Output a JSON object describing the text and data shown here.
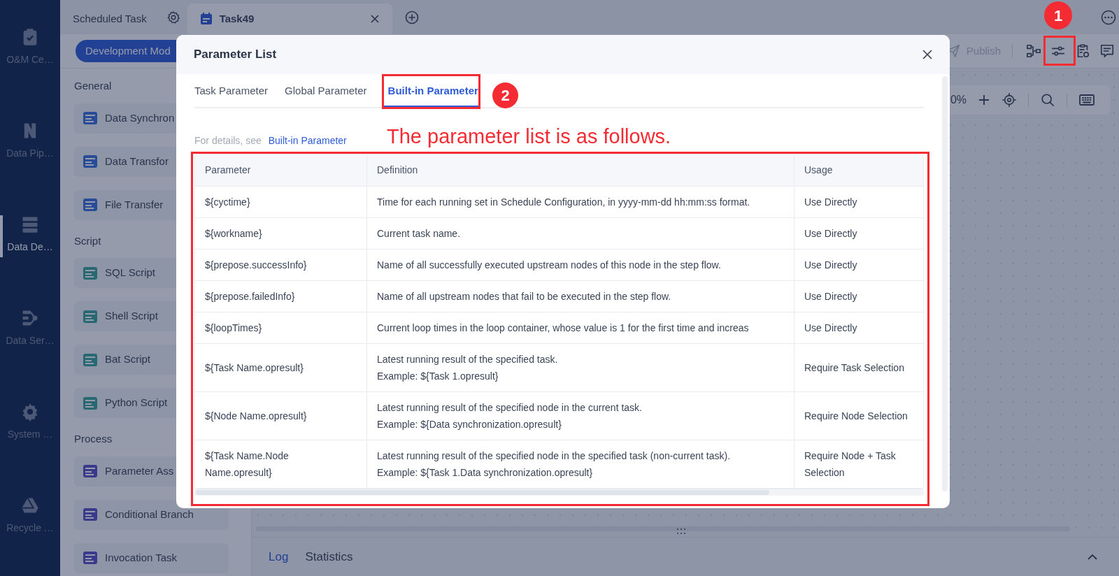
{
  "nav": [
    {
      "label": "O&M Ce…",
      "selected": false
    },
    {
      "label": "Data Pip…",
      "selected": false
    },
    {
      "label": "Data De…",
      "selected": true
    },
    {
      "label": "Data Ser…",
      "selected": false
    },
    {
      "label": "System …",
      "selected": false
    },
    {
      "label": "Recycle …",
      "selected": false
    }
  ],
  "top_tabs": [
    {
      "label": "Scheduled Task",
      "kind": "home",
      "selected": false
    },
    {
      "label": "Task49",
      "kind": "task",
      "selected": true
    }
  ],
  "mode_button": "Development Mod",
  "publish": {
    "label": "Publish",
    "disabled": true
  },
  "palette": [
    {
      "title": "General",
      "items": [
        "Data Synchron",
        "Data Transfor",
        "File Transfer"
      ]
    },
    {
      "title": "Script",
      "items": [
        "SQL Script",
        "Shell Script",
        "Bat Script",
        "Python Script"
      ]
    },
    {
      "title": "Process",
      "items": [
        "Parameter Ass",
        "Conditional Branch",
        "Invocation Task"
      ]
    }
  ],
  "zoom_toolbar": {
    "zoom": "0%"
  },
  "bottom_panel": {
    "tabs": [
      {
        "label": "Log",
        "selected": true
      },
      {
        "label": "Statistics",
        "selected": false
      }
    ]
  },
  "dialog": {
    "title": "Parameter List",
    "tabs": [
      {
        "label": "Task Parameter",
        "selected": false,
        "highlighted": false
      },
      {
        "label": "Global Parameter",
        "selected": false,
        "highlighted": false
      },
      {
        "label": "Built-in Parameter",
        "selected": true,
        "highlighted": true
      }
    ],
    "hint": "For details, see",
    "hint_link": "Built-in Parameter",
    "columns": [
      "Parameter",
      "Definition",
      "Usage"
    ],
    "rows": [
      {
        "parameter": "${cyctime}",
        "definition": [
          "Time for each running set in Schedule Configuration, in yyyy-mm-dd hh:mm:ss format."
        ],
        "usage": "Use Directly"
      },
      {
        "parameter": "${workname}",
        "definition": [
          "Current task name."
        ],
        "usage": "Use Directly"
      },
      {
        "parameter": "${prepose.successInfo}",
        "definition": [
          "Name of all successfully executed upstream nodes of this node in the step flow."
        ],
        "usage": "Use Directly"
      },
      {
        "parameter": "${prepose.failedInfo}",
        "definition": [
          "Name of all upstream nodes that fail to be executed in the step flow."
        ],
        "usage": "Use Directly"
      },
      {
        "parameter": "${loopTimes}",
        "definition": [
          "Current loop times in the loop container, whose value is 1 for the first time and increas"
        ],
        "usage": "Use Directly"
      },
      {
        "parameter": "${Task Name.opresult}",
        "definition": [
          "Latest running result of the specified task.",
          "Example: ${Task 1.opresult}"
        ],
        "usage": "Require Task Selection"
      },
      {
        "parameter": "${Node Name.opresult}",
        "definition": [
          "Latest running result of the specified node in the current task.",
          "Example: ${Data synchronization.opresult}"
        ],
        "usage": "Require Node Selection"
      },
      {
        "parameter": "${Task Name.Node Name.opresult}",
        "definition": [
          "Latest running result of the specified node in the specified task (non-current task).",
          "Example: ${Task 1.Data synchronization.opresult}"
        ],
        "usage": "Require Node + Task Selection"
      }
    ]
  },
  "annotations": [
    {
      "kind": "marker",
      "number": "1"
    },
    {
      "kind": "marker",
      "number": "2"
    },
    {
      "kind": "callout",
      "text": "The parameter list is as follows."
    }
  ]
}
